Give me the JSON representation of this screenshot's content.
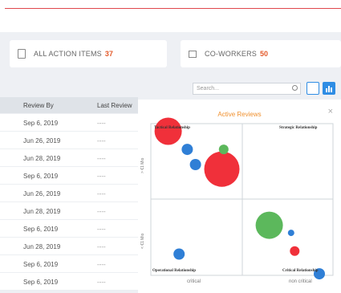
{
  "summary": {
    "action_items_label": "ALL ACTION ITEMS",
    "action_items_count": "37",
    "coworkers_label": "CO-WORKERS",
    "coworkers_count": "50"
  },
  "search": {
    "placeholder": "Search..."
  },
  "table": {
    "headers": [
      "Review By",
      "Last Review"
    ],
    "rows": [
      {
        "review_by": "Sep 6, 2019",
        "last_review": "----"
      },
      {
        "review_by": "Jun 26, 2019",
        "last_review": "----"
      },
      {
        "review_by": "Jun 28, 2019",
        "last_review": "----"
      },
      {
        "review_by": "Sep 6, 2019",
        "last_review": "----"
      },
      {
        "review_by": "Jun 26, 2019",
        "last_review": "----"
      },
      {
        "review_by": "Jun 28, 2019",
        "last_review": "----"
      },
      {
        "review_by": "Sep 6, 2019",
        "last_review": "----"
      },
      {
        "review_by": "Jun 28, 2019",
        "last_review": "----"
      },
      {
        "review_by": "Sep 6, 2019",
        "last_review": "----"
      },
      {
        "review_by": "Sep 6, 2019",
        "last_review": "----"
      }
    ]
  },
  "popup": {
    "title": "Active Reviews",
    "close_symbol": "×",
    "quadrants": {
      "top_left": "Tactical Relationship",
      "top_right": "Strategic Relationship",
      "bottom_left": "Operational Relationship",
      "bottom_right": "Critical Relationship"
    },
    "y_axis": {
      "top_label": "> €1 Mio",
      "bottom_label": "< €1 Mio"
    },
    "x_axis": {
      "left_label": "critical",
      "right_label": "non critical"
    }
  },
  "chart_data": {
    "type": "scatter",
    "title": "Active Reviews",
    "note": "bubble positions estimated within a 2x2 matrix, x and y from 0 to 1",
    "xlim": [
      0,
      1
    ],
    "ylim": [
      0,
      1
    ],
    "colors": {
      "red": "#f0303a",
      "blue": "#2f7fd6",
      "green": "#5cb85c"
    },
    "points": [
      {
        "x": 0.19,
        "y": 0.95,
        "r": 17,
        "color": "red"
      },
      {
        "x": 0.4,
        "y": 0.83,
        "r": 7,
        "color": "blue"
      },
      {
        "x": 0.49,
        "y": 0.73,
        "r": 7,
        "color": "blue"
      },
      {
        "x": 0.78,
        "y": 0.7,
        "r": 22,
        "color": "red"
      },
      {
        "x": 0.31,
        "y": 0.14,
        "r": 7,
        "color": "blue"
      },
      {
        "x": 0.8,
        "y": 0.83,
        "r": 6,
        "color": "green"
      },
      {
        "x": 1.3,
        "y": 0.33,
        "r": 17,
        "color": "green"
      },
      {
        "x": 1.54,
        "y": 0.28,
        "r": 4,
        "color": "blue"
      },
      {
        "x": 1.58,
        "y": 0.16,
        "r": 6,
        "color": "red"
      },
      {
        "x": 1.85,
        "y": 0.01,
        "r": 7,
        "color": "blue"
      }
    ]
  }
}
